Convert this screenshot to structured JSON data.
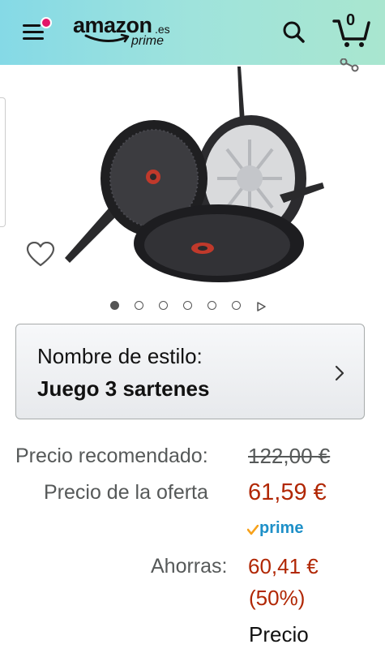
{
  "header": {
    "logo_word": "amazon",
    "logo_tld": ".es",
    "logo_prime": "prime",
    "cart_count": "0",
    "colors": {
      "gradient_start": "#85d9e6",
      "gradient_end": "#a9e6cf",
      "notification_dot": "#e3176a"
    }
  },
  "gallery": {
    "image_count": 6,
    "active_index": 0,
    "product_image": "three frying pans (sartenes) set"
  },
  "style": {
    "label": "Nombre de estilo:",
    "value": "Juego 3 sartenes"
  },
  "price": {
    "recommended_label": "Precio recomendado:",
    "recommended_value": "122,00 €",
    "offer_label": "Precio de la oferta",
    "offer_value": "61,59 €",
    "prime_label": "prime",
    "savings_label": "Ahorras:",
    "savings_value": "60,41 €",
    "savings_percent": "(50%)",
    "more_label": "Precio",
    "colors": {
      "price_red": "#b12704",
      "prime_blue": "#1e90c8",
      "prime_check": "#f7a11a"
    }
  }
}
